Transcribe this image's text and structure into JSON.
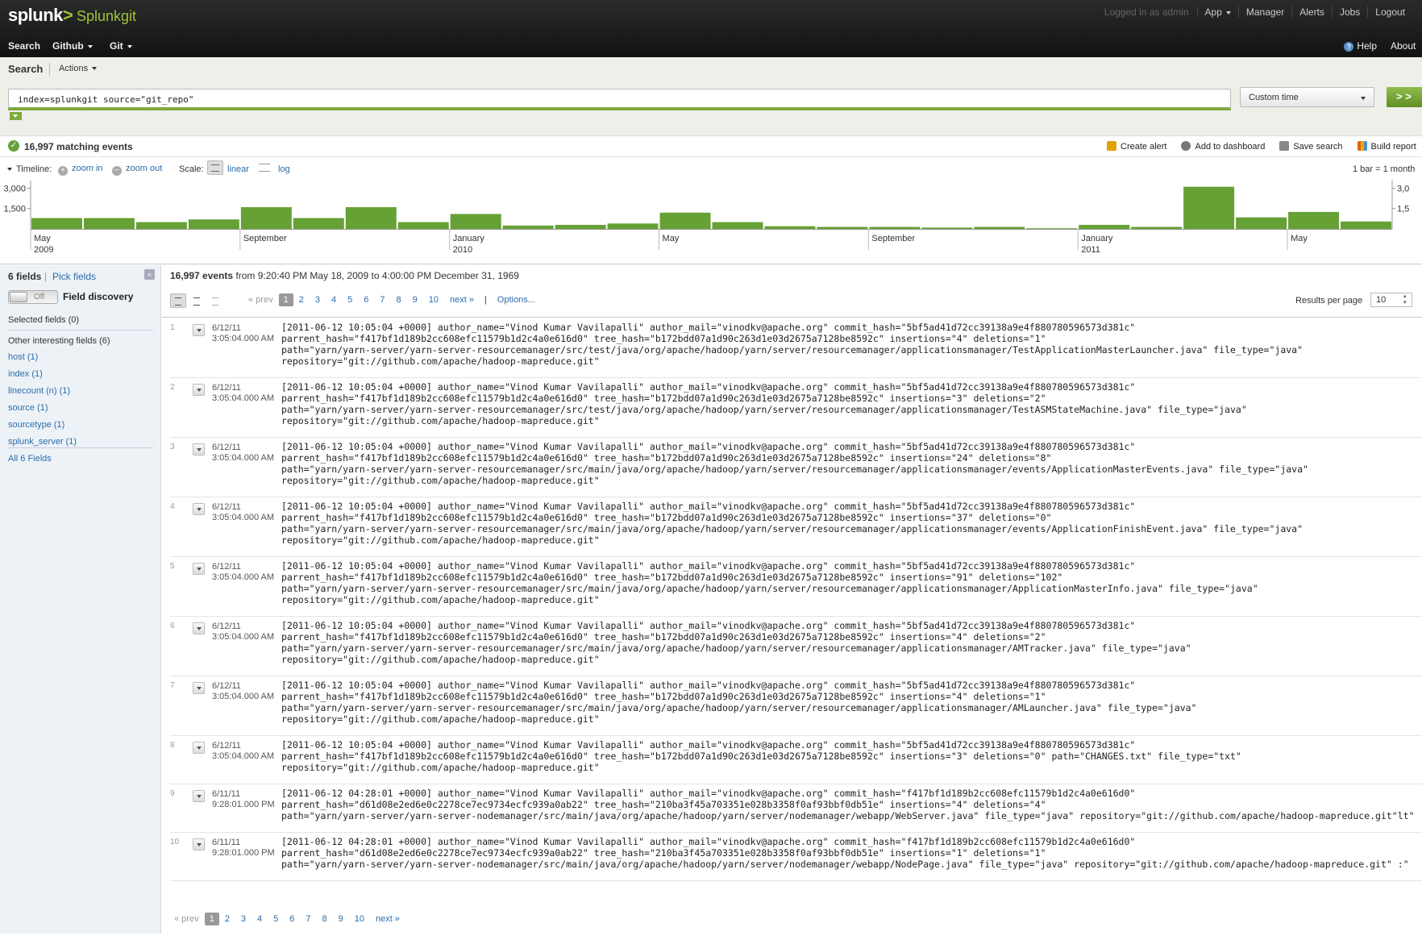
{
  "header": {
    "logo": "splunk",
    "logo_mark": ">",
    "app_name": "Splunkgit",
    "logged_in": "Logged in as admin",
    "links": [
      "App",
      "Manager",
      "Alerts",
      "Jobs",
      "Logout"
    ],
    "nav": [
      "Search",
      "Github",
      "Git"
    ],
    "help": "Help",
    "about": "About"
  },
  "search": {
    "title": "Search",
    "actions": "Actions",
    "query": "index=splunkgit source=\"git_repo\"",
    "time_range": "Custom time",
    "go": "> >"
  },
  "results_bar": {
    "matching": "16,997 matching events",
    "create_alert": "Create alert",
    "add_dashboard": "Add to dashboard",
    "save_search": "Save search",
    "build_report": "Build report"
  },
  "timeline": {
    "label": "Timeline:",
    "zoom_in": "zoom in",
    "zoom_out": "zoom out",
    "scale": "Scale:",
    "linear": "linear",
    "log": "log",
    "bar_info": "1 bar = 1 month"
  },
  "chart_data": {
    "type": "bar",
    "categories": [
      "2009-05",
      "2009-06",
      "2009-07",
      "2009-08",
      "2009-09",
      "2009-10",
      "2009-11",
      "2009-12",
      "2010-01",
      "2010-02",
      "2010-03",
      "2010-04",
      "2010-05",
      "2010-06",
      "2010-07",
      "2010-08",
      "2010-09",
      "2010-10",
      "2010-11",
      "2010-12",
      "2011-01",
      "2011-02",
      "2011-03",
      "2011-04",
      "2011-05",
      "2011-06"
    ],
    "values": [
      800,
      800,
      500,
      700,
      1600,
      800,
      1600,
      500,
      1100,
      250,
      300,
      400,
      1200,
      500,
      200,
      150,
      150,
      100,
      150,
      50,
      300,
      150,
      3100,
      850,
      1250,
      550
    ],
    "ylim": [
      0,
      3200
    ],
    "ticks": [
      "3,000",
      "1,500"
    ],
    "tick_values": [
      3000,
      1500
    ],
    "right_ticks": [
      "3,0",
      "1,5"
    ],
    "x_labels": [
      {
        "index": 0,
        "month": "May",
        "year": "2009"
      },
      {
        "index": 4,
        "month": "September",
        "year": ""
      },
      {
        "index": 8,
        "month": "January",
        "year": "2010"
      },
      {
        "index": 12,
        "month": "May",
        "year": ""
      },
      {
        "index": 16,
        "month": "September",
        "year": ""
      },
      {
        "index": 20,
        "month": "January",
        "year": "2011"
      },
      {
        "index": 24,
        "month": "May",
        "year": ""
      }
    ],
    "bar_color": "#65a135"
  },
  "sidebar": {
    "field_count": "6 fields",
    "pick_fields": "Pick fields",
    "toggle": "Off",
    "field_discovery": "Field discovery",
    "selected": "Selected fields (0)",
    "other": "Other interesting fields (6)",
    "fields": [
      {
        "name": "host",
        "count": " (1)"
      },
      {
        "name": "index",
        "count": " (1)"
      },
      {
        "name": "linecount (n)",
        "count": " (1)"
      },
      {
        "name": "source",
        "count": " (1)"
      },
      {
        "name": "sourcetype",
        "count": " (1)"
      },
      {
        "name": "splunk_server",
        "count": " (1)"
      }
    ],
    "all": "All 6 Fields"
  },
  "events": {
    "count": "16,997 events",
    "range": " from 9:20:40 PM May 18, 2009 to 4:00:00 PM December 31, 1969",
    "pager": {
      "prev": "« prev",
      "pages": [
        "1",
        "2",
        "3",
        "4",
        "5",
        "6",
        "7",
        "8",
        "9",
        "10"
      ],
      "next": "next »",
      "options": "Options..."
    },
    "results_per_page_label": "Results per page",
    "results_per_page": "10",
    "rows": [
      {
        "num": "1",
        "date": "6/12/11",
        "time": "3:05:04.000 AM",
        "lines": [
          "[2011-06-12 10:05:04 +0000] author_name=\"Vinod Kumar Vavilapalli\" author_mail=\"vinodkv@apache.org\" commit_hash=\"5bf5ad41d72cc39138a9e4f880780596573d381c\"",
          "parrent_hash=\"f417bf1d189b2cc608efc11579b1d2c4a0e616d0\" tree_hash=\"b172bdd07a1d90c263d1e03d2675a7128be8592c\" insertions=\"4\" deletions=\"1\"",
          "path=\"yarn/yarn-server/yarn-server-resourcemanager/src/test/java/org/apache/hadoop/yarn/server/resourcemanager/applicationsmanager/TestApplicationMasterLauncher.java\" file_type=\"java\"",
          "repository=\"git://github.com/apache/hadoop-mapreduce.git\""
        ]
      },
      {
        "num": "2",
        "date": "6/12/11",
        "time": "3:05:04.000 AM",
        "lines": [
          "[2011-06-12 10:05:04 +0000] author_name=\"Vinod Kumar Vavilapalli\" author_mail=\"vinodkv@apache.org\" commit_hash=\"5bf5ad41d72cc39138a9e4f880780596573d381c\"",
          "parrent_hash=\"f417bf1d189b2cc608efc11579b1d2c4a0e616d0\" tree_hash=\"b172bdd07a1d90c263d1e03d2675a7128be8592c\" insertions=\"3\" deletions=\"2\"",
          "path=\"yarn/yarn-server/yarn-server-resourcemanager/src/test/java/org/apache/hadoop/yarn/server/resourcemanager/applicationsmanager/TestASMStateMachine.java\" file_type=\"java\"",
          "repository=\"git://github.com/apache/hadoop-mapreduce.git\""
        ]
      },
      {
        "num": "3",
        "date": "6/12/11",
        "time": "3:05:04.000 AM",
        "lines": [
          "[2011-06-12 10:05:04 +0000] author_name=\"Vinod Kumar Vavilapalli\" author_mail=\"vinodkv@apache.org\" commit_hash=\"5bf5ad41d72cc39138a9e4f880780596573d381c\"",
          "parrent_hash=\"f417bf1d189b2cc608efc11579b1d2c4a0e616d0\" tree_hash=\"b172bdd07a1d90c263d1e03d2675a7128be8592c\" insertions=\"24\" deletions=\"8\"",
          "path=\"yarn/yarn-server/yarn-server-resourcemanager/src/main/java/org/apache/hadoop/yarn/server/resourcemanager/applicationsmanager/events/ApplicationMasterEvents.java\" file_type=\"java\"",
          "repository=\"git://github.com/apache/hadoop-mapreduce.git\""
        ]
      },
      {
        "num": "4",
        "date": "6/12/11",
        "time": "3:05:04.000 AM",
        "lines": [
          "[2011-06-12 10:05:04 +0000] author_name=\"Vinod Kumar Vavilapalli\" author_mail=\"vinodkv@apache.org\" commit_hash=\"5bf5ad41d72cc39138a9e4f880780596573d381c\"",
          "parrent_hash=\"f417bf1d189b2cc608efc11579b1d2c4a0e616d0\" tree_hash=\"b172bdd07a1d90c263d1e03d2675a7128be8592c\" insertions=\"37\" deletions=\"0\"",
          "path=\"yarn/yarn-server/yarn-server-resourcemanager/src/main/java/org/apache/hadoop/yarn/server/resourcemanager/applicationsmanager/events/ApplicationFinishEvent.java\" file_type=\"java\"",
          "repository=\"git://github.com/apache/hadoop-mapreduce.git\""
        ]
      },
      {
        "num": "5",
        "date": "6/12/11",
        "time": "3:05:04.000 AM",
        "lines": [
          "[2011-06-12 10:05:04 +0000] author_name=\"Vinod Kumar Vavilapalli\" author_mail=\"vinodkv@apache.org\" commit_hash=\"5bf5ad41d72cc39138a9e4f880780596573d381c\"",
          "parrent_hash=\"f417bf1d189b2cc608efc11579b1d2c4a0e616d0\" tree_hash=\"b172bdd07a1d90c263d1e03d2675a7128be8592c\" insertions=\"91\" deletions=\"102\"",
          "path=\"yarn/yarn-server/yarn-server-resourcemanager/src/main/java/org/apache/hadoop/yarn/server/resourcemanager/applicationsmanager/ApplicationMasterInfo.java\" file_type=\"java\"",
          "repository=\"git://github.com/apache/hadoop-mapreduce.git\""
        ]
      },
      {
        "num": "6",
        "date": "6/12/11",
        "time": "3:05:04.000 AM",
        "lines": [
          "[2011-06-12 10:05:04 +0000] author_name=\"Vinod Kumar Vavilapalli\" author_mail=\"vinodkv@apache.org\" commit_hash=\"5bf5ad41d72cc39138a9e4f880780596573d381c\"",
          "parrent_hash=\"f417bf1d189b2cc608efc11579b1d2c4a0e616d0\" tree_hash=\"b172bdd07a1d90c263d1e03d2675a7128be8592c\" insertions=\"4\" deletions=\"2\"",
          "path=\"yarn/yarn-server/yarn-server-resourcemanager/src/main/java/org/apache/hadoop/yarn/server/resourcemanager/applicationsmanager/AMTracker.java\" file_type=\"java\"",
          "repository=\"git://github.com/apache/hadoop-mapreduce.git\""
        ]
      },
      {
        "num": "7",
        "date": "6/12/11",
        "time": "3:05:04.000 AM",
        "lines": [
          "[2011-06-12 10:05:04 +0000] author_name=\"Vinod Kumar Vavilapalli\" author_mail=\"vinodkv@apache.org\" commit_hash=\"5bf5ad41d72cc39138a9e4f880780596573d381c\"",
          "parrent_hash=\"f417bf1d189b2cc608efc11579b1d2c4a0e616d0\" tree_hash=\"b172bdd07a1d90c263d1e03d2675a7128be8592c\" insertions=\"4\" deletions=\"1\"",
          "path=\"yarn/yarn-server/yarn-server-resourcemanager/src/main/java/org/apache/hadoop/yarn/server/resourcemanager/applicationsmanager/AMLauncher.java\" file_type=\"java\"",
          "repository=\"git://github.com/apache/hadoop-mapreduce.git\""
        ]
      },
      {
        "num": "8",
        "date": "6/12/11",
        "time": "3:05:04.000 AM",
        "lines": [
          "[2011-06-12 10:05:04 +0000] author_name=\"Vinod Kumar Vavilapalli\" author_mail=\"vinodkv@apache.org\" commit_hash=\"5bf5ad41d72cc39138a9e4f880780596573d381c\"",
          "parrent_hash=\"f417bf1d189b2cc608efc11579b1d2c4a0e616d0\" tree_hash=\"b172bdd07a1d90c263d1e03d2675a7128be8592c\" insertions=\"3\" deletions=\"0\" path=\"CHANGES.txt\" file_type=\"txt\"",
          "repository=\"git://github.com/apache/hadoop-mapreduce.git\""
        ]
      },
      {
        "num": "9",
        "date": "6/11/11",
        "time": "9:28:01.000 PM",
        "lines": [
          "[2011-06-12 04:28:01 +0000] author_name=\"Vinod Kumar Vavilapalli\" author_mail=\"vinodkv@apache.org\" commit_hash=\"f417bf1d189b2cc608efc11579b1d2c4a0e616d0\"",
          "parrent_hash=\"d61d08e2ed6e0c2278ce7ec9734ecfc939a0ab22\" tree_hash=\"210ba3f45a703351e028b3358f0af93bbf0db51e\" insertions=\"4\" deletions=\"4\"",
          "path=\"yarn/yarn-server/yarn-server-nodemanager/src/main/java/org/apache/hadoop/yarn/server/nodemanager/webapp/WebServer.java\" file_type=\"java\" repository=\"git://github.com/apache/hadoop-mapreduce.git\"lt\""
        ]
      },
      {
        "num": "10",
        "date": "6/11/11",
        "time": "9:28:01.000 PM",
        "lines": [
          "[2011-06-12 04:28:01 +0000] author_name=\"Vinod Kumar Vavilapalli\" author_mail=\"vinodkv@apache.org\" commit_hash=\"f417bf1d189b2cc608efc11579b1d2c4a0e616d0\"",
          "parrent_hash=\"d61d08e2ed6e0c2278ce7ec9734ecfc939a0ab22\" tree_hash=\"210ba3f45a703351e028b3358f0af93bbf0db51e\" insertions=\"1\" deletions=\"1\"",
          "path=\"yarn/yarn-server/yarn-server-nodemanager/src/main/java/org/apache/hadoop/yarn/server/nodemanager/webapp/NodePage.java\" file_type=\"java\" repository=\"git://github.com/apache/hadoop-mapreduce.git\" :\""
        ]
      }
    ]
  }
}
